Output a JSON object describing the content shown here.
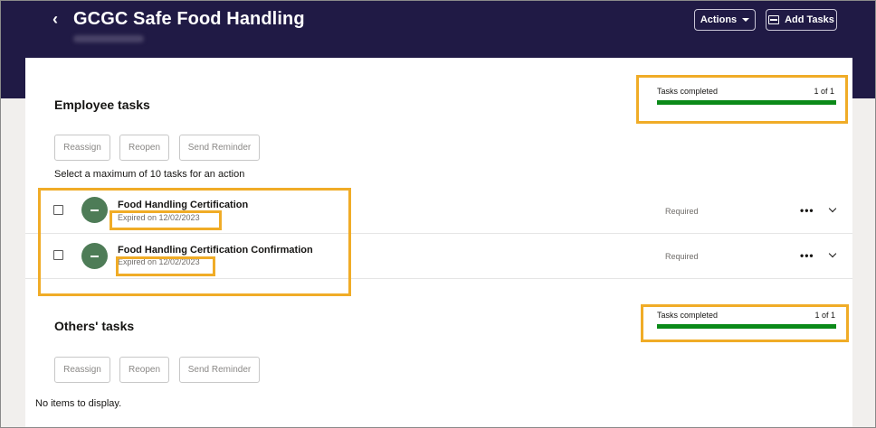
{
  "header": {
    "back_glyph": "‹",
    "title": "GCGC Safe Food Handling",
    "actions_label": "Actions",
    "add_tasks_label": "Add Tasks"
  },
  "employee": {
    "title": "Employee tasks",
    "progress_label": "Tasks completed",
    "progress_count": "1 of 1",
    "progress_fraction": 1.0,
    "buttons": {
      "reassign": "Reassign",
      "reopen": "Reopen",
      "send_reminder": "Send Reminder"
    },
    "hint": "Select a maximum of 10 tasks for an action",
    "tasks": [
      {
        "name": "Food Handling Certification",
        "date": "Expired on 12/02/2023",
        "requirement": "Required",
        "more_glyph": "•••"
      },
      {
        "name": "Food Handling Certification Confirmation",
        "date": "Expired on 12/02/2023",
        "requirement": "Required",
        "more_glyph": "•••"
      }
    ]
  },
  "others": {
    "title": "Others' tasks",
    "progress_label": "Tasks completed",
    "progress_count": "1 of 1",
    "progress_fraction": 1.0,
    "buttons": {
      "reassign": "Reassign",
      "reopen": "Reopen",
      "send_reminder": "Send Reminder"
    },
    "empty_text": "No items to display."
  },
  "colors": {
    "header_bg": "#201a45",
    "highlight": "#f0ac27",
    "progress_fill": "#0b8a19",
    "status_circle": "#4e7c57"
  }
}
